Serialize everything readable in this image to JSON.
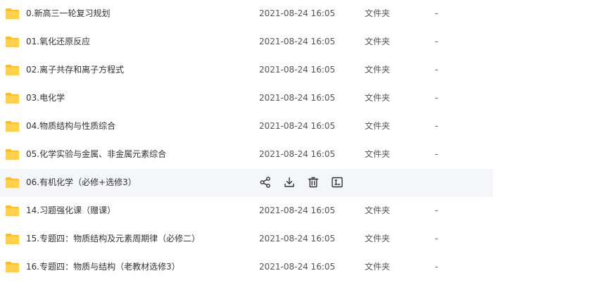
{
  "files": [
    {
      "name": "0.新高三一轮复习规划",
      "date": "2021-08-24 16:05",
      "type": "文件夹",
      "size": "-"
    },
    {
      "name": "01.氧化还原反应",
      "date": "2021-08-24 16:05",
      "type": "文件夹",
      "size": "-"
    },
    {
      "name": "02.离子共存和离子方程式",
      "date": "2021-08-24 16:05",
      "type": "文件夹",
      "size": "-"
    },
    {
      "name": "03.电化学",
      "date": "2021-08-24 16:05",
      "type": "文件夹",
      "size": "-"
    },
    {
      "name": "04.物质结构与性质综合",
      "date": "2021-08-24 16:05",
      "type": "文件夹",
      "size": "-"
    },
    {
      "name": "05.化学实验与金属、非金属元素综合",
      "date": "2021-08-24 16:05",
      "type": "文件夹",
      "size": "-"
    },
    {
      "name": "06.有机化学（必修+选修3）"
    },
    {
      "name": "14.习题强化课（赠课）",
      "date": "2021-08-24 16:05",
      "type": "文件夹",
      "size": "-"
    },
    {
      "name": "15.专题四：物质结构及元素周期律（必修二）",
      "date": "2021-08-24 16:05",
      "type": "文件夹",
      "size": "-"
    },
    {
      "name": "16.专题四：物质与结构（老教材选修3）",
      "date": "2021-08-24 16:05",
      "type": "文件夹",
      "size": "-"
    }
  ],
  "hover_actions": [
    "share-icon",
    "download-icon",
    "delete-icon",
    "rename-icon"
  ],
  "colors": {
    "folder": "#ffd04b",
    "folder_tab": "#f5b82e",
    "hover_row": "#f5f6fa",
    "icon": "#333333"
  }
}
